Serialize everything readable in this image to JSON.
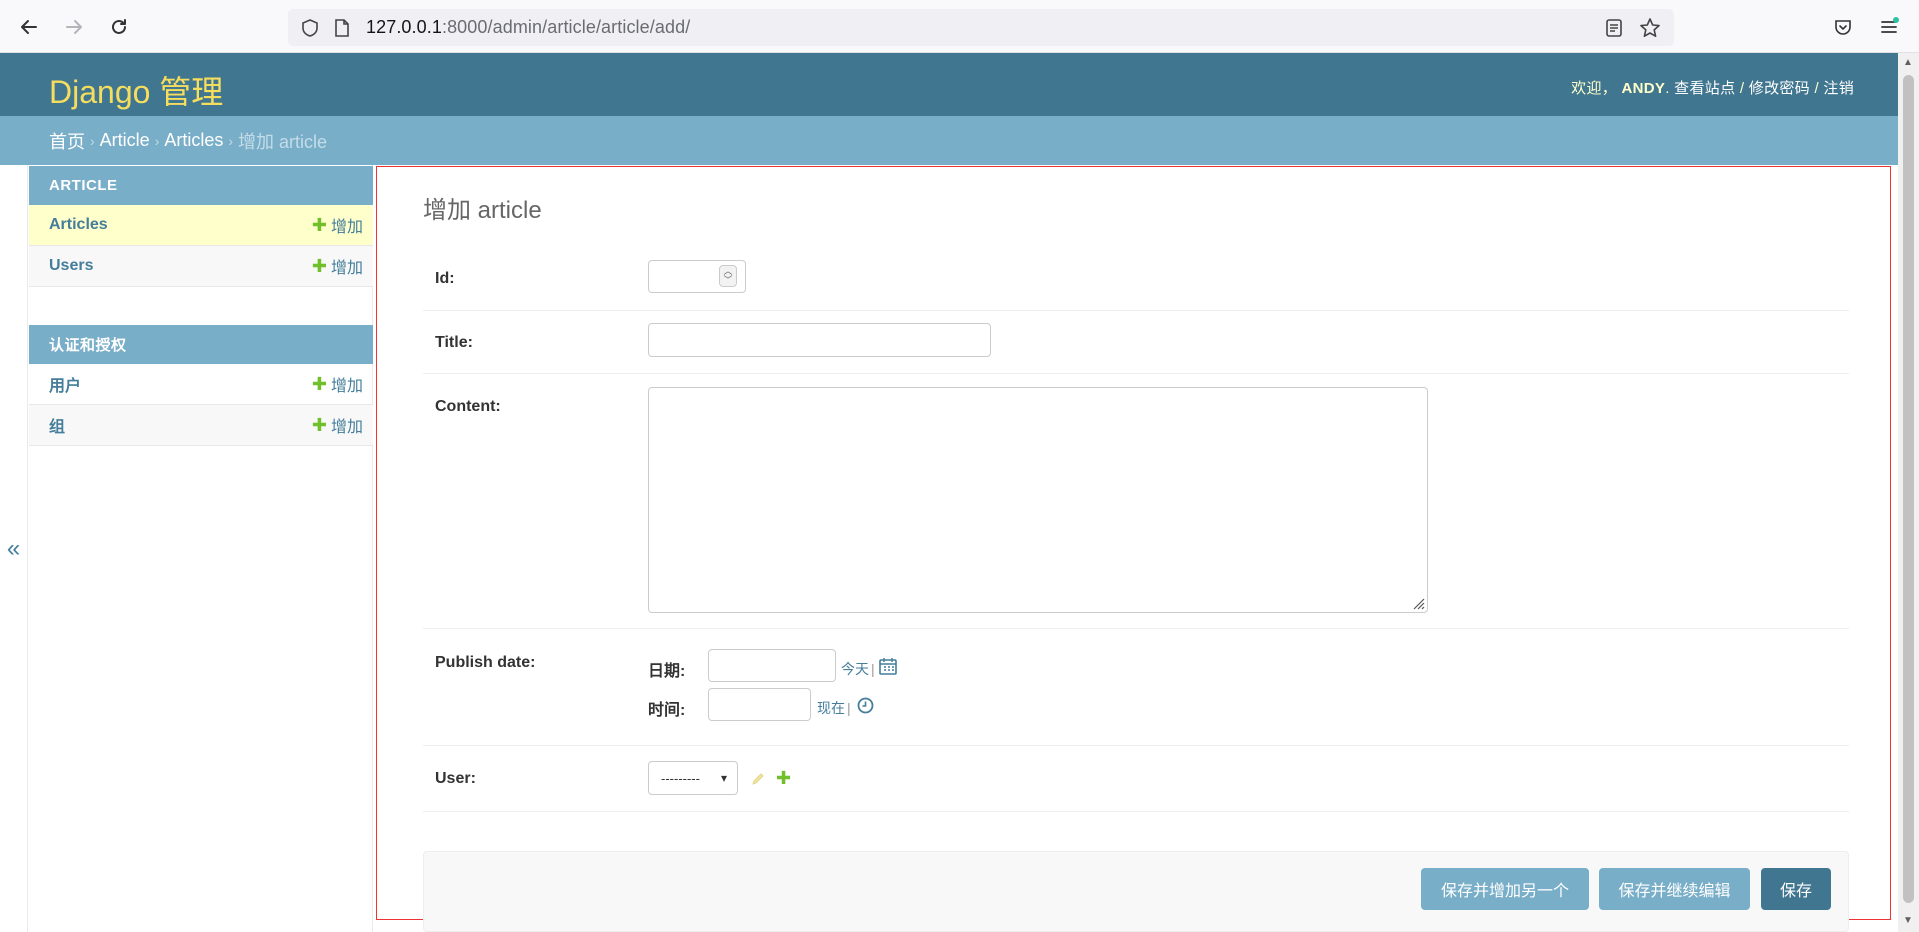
{
  "browser": {
    "url_host": "127.0.0.1",
    "url_rest": ":8000/admin/article/article/add/"
  },
  "header": {
    "branding": "Django 管理",
    "welcome": "欢迎，",
    "username": "ANDY",
    "view_site": "查看站点",
    "change_password": "修改密码",
    "logout": "注销",
    "sep": " / "
  },
  "breadcrumbs": {
    "home": "首页",
    "app": "Article",
    "model": "Articles",
    "current": "增加 article",
    "sep": "›"
  },
  "sidebar": {
    "modules": [
      {
        "caption": "ARTICLE",
        "rows": [
          {
            "name": "Articles",
            "add": "增加"
          },
          {
            "name": "Users",
            "add": "增加"
          }
        ]
      },
      {
        "caption": "认证和授权",
        "rows": [
          {
            "name": "用户",
            "add": "增加"
          },
          {
            "name": "组",
            "add": "增加"
          }
        ]
      }
    ],
    "toggle": "«"
  },
  "form": {
    "title": "增加 article",
    "fields": {
      "id": {
        "label": "Id:",
        "value": ""
      },
      "title": {
        "label": "Title:",
        "value": ""
      },
      "content": {
        "label": "Content:",
        "value": ""
      },
      "publish_date": {
        "label": "Publish date:",
        "date_label": "日期:",
        "date_value": "",
        "today": "今天",
        "time_label": "时间:",
        "time_value": "",
        "now": "现在",
        "pipe": "|"
      },
      "user": {
        "label": "User:",
        "selected": "---------"
      }
    },
    "buttons": {
      "save_add_another": "保存并增加另一个",
      "save_continue": "保存并继续编辑",
      "save": "保存"
    }
  },
  "colors": {
    "header": "#417690",
    "breadcrumbs": "#79aec8",
    "branding": "#f5dd5d",
    "link": "#447e9b",
    "add_plus": "#70bf2b",
    "selected_row": "#ffffcc",
    "outline": "#ee3333"
  },
  "icons": {
    "back": "arrow-left-icon",
    "forward": "arrow-right-icon",
    "reload": "reload-icon",
    "shield": "shield-icon",
    "page": "page-icon",
    "reader": "reader-view-icon",
    "bookmark": "star-icon",
    "pocket": "pocket-icon",
    "menu": "hamburger-menu-icon",
    "calendar": "calendar-icon",
    "clock": "clock-icon",
    "edit": "pencil-icon",
    "add": "plus-icon"
  }
}
